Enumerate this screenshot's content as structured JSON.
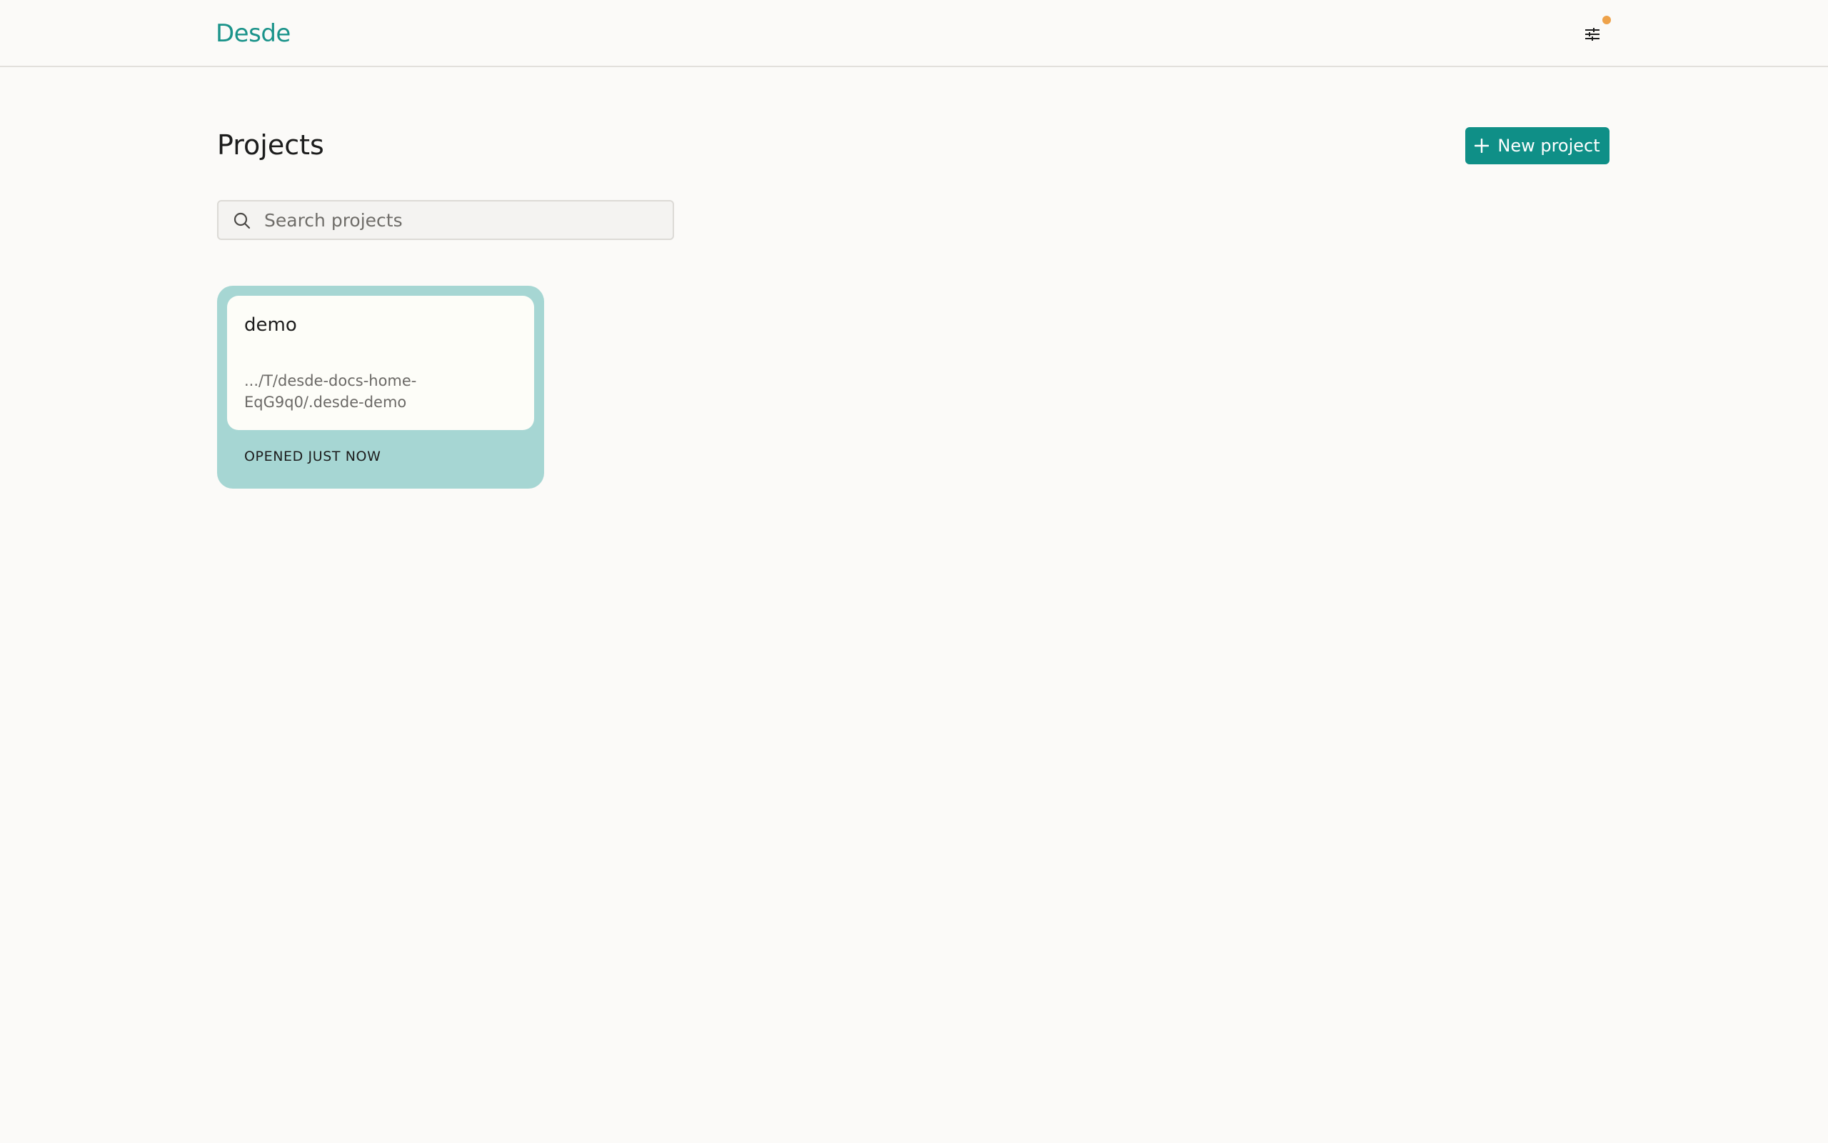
{
  "app": {
    "logo": "Desde"
  },
  "header": {
    "settings_icon": "sliders-icon",
    "notification_color": "#eea24a"
  },
  "main": {
    "title": "Projects",
    "new_project_label": "New project",
    "search": {
      "placeholder": "Search projects",
      "value": ""
    },
    "projects": [
      {
        "name": "demo",
        "path_line1": ".../T/desde-docs-home-",
        "path_line2": "EqG9q0/.desde-demo",
        "opened": "OPENED JUST NOW"
      }
    ]
  },
  "colors": {
    "accent": "#0f8f87",
    "logo": "#1a938a",
    "card_bg": "#a6d6d3",
    "background": "#fbfaf8"
  }
}
